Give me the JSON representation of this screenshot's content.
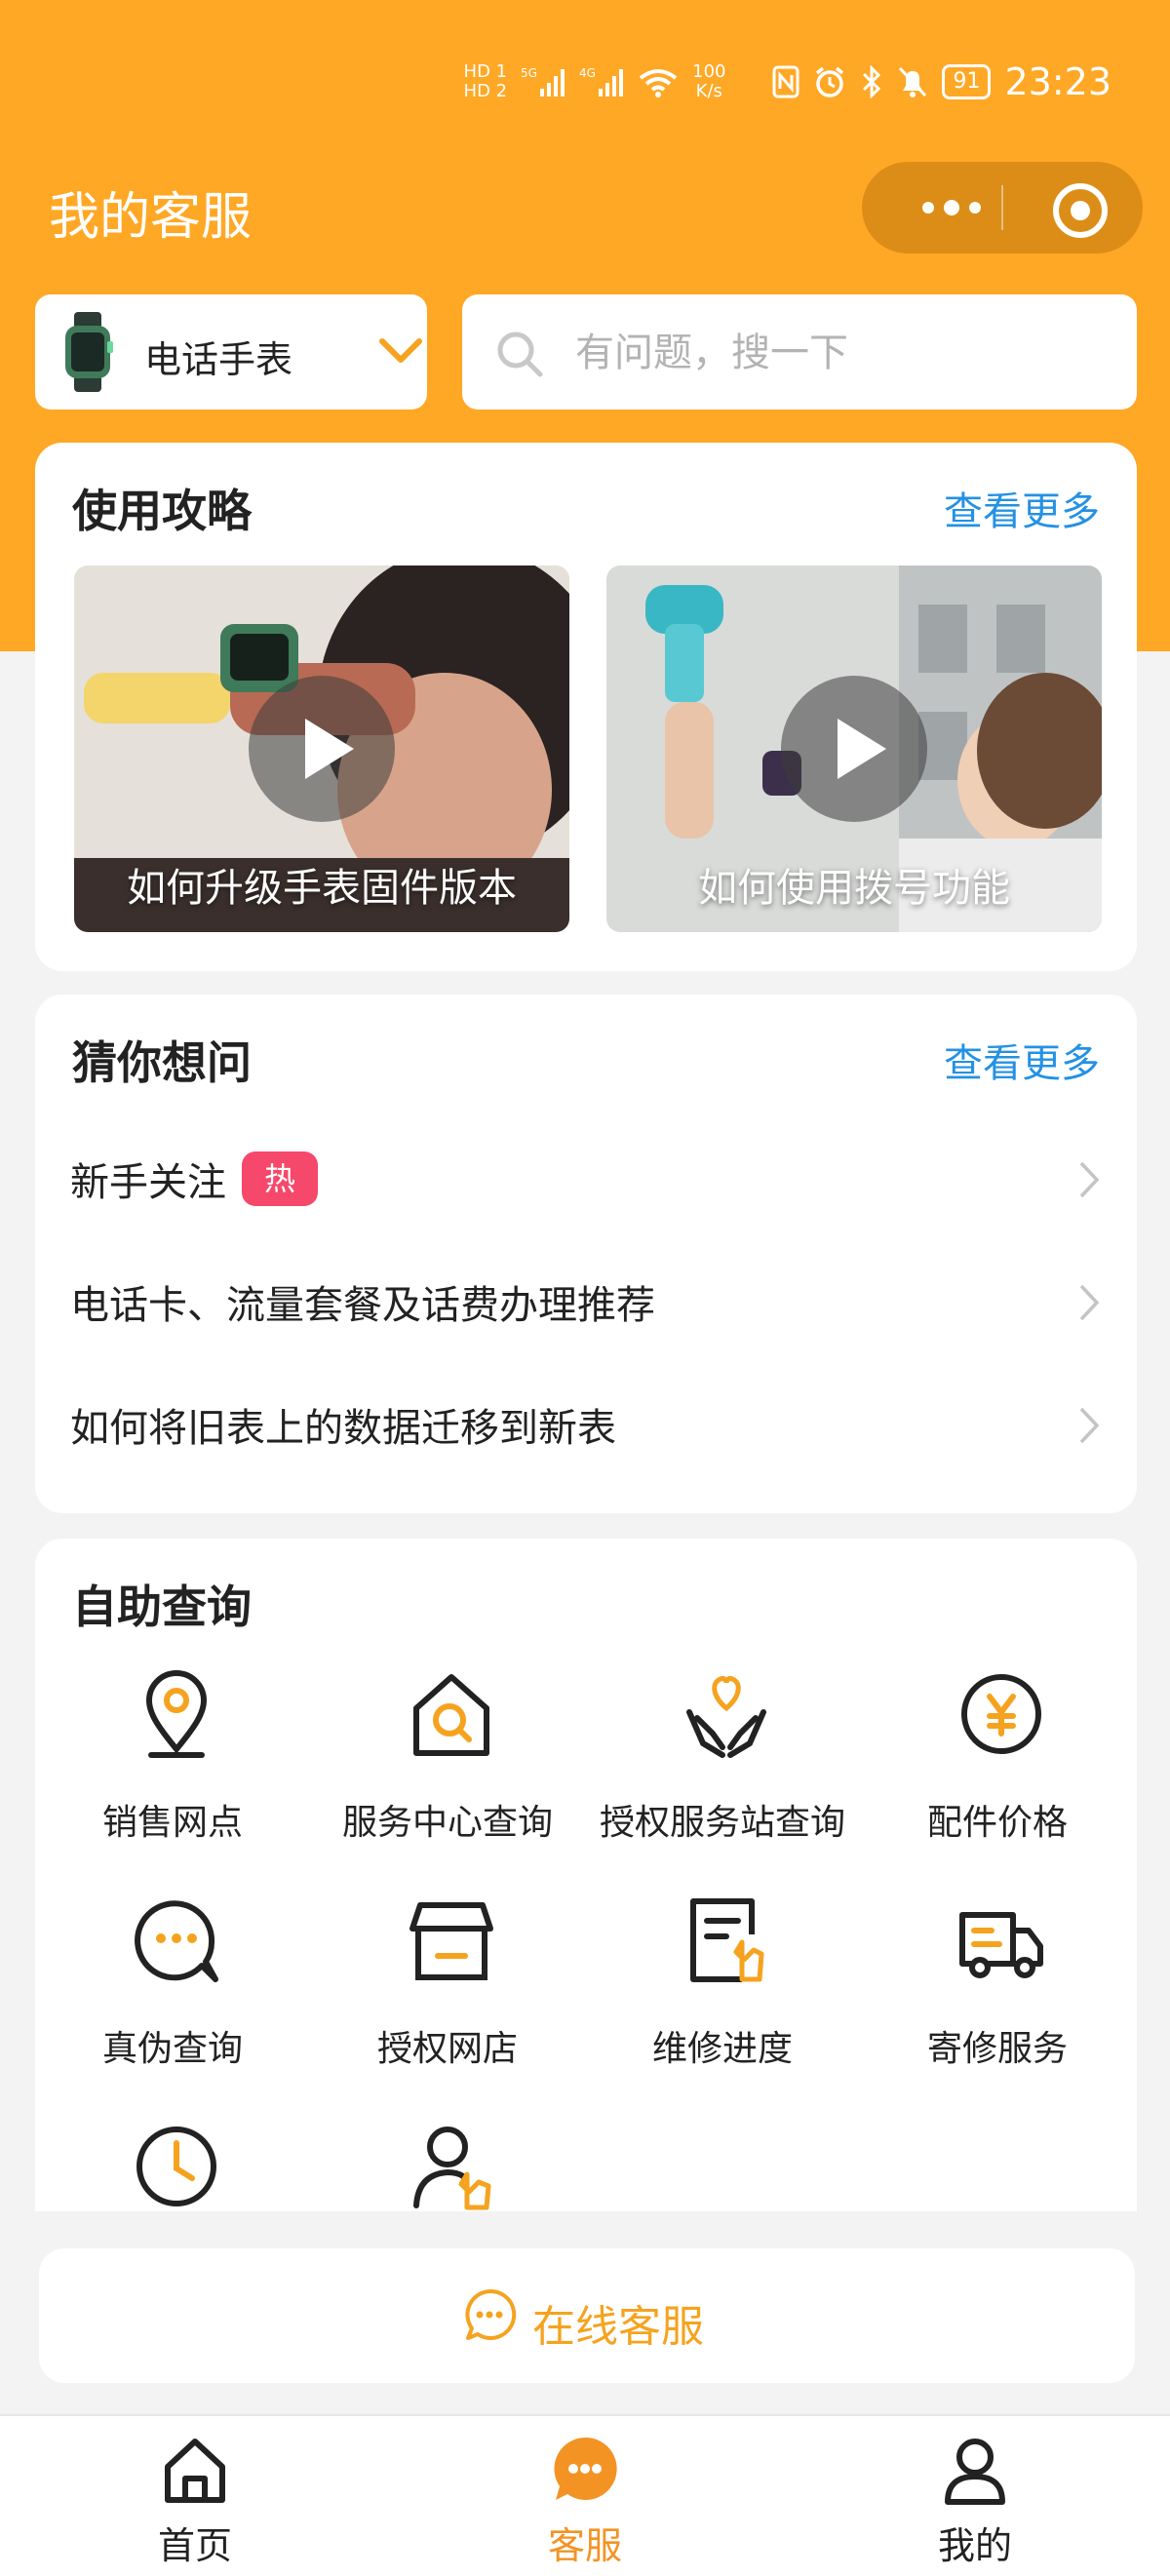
{
  "status_bar": {
    "net_top": "HD 1",
    "net_bottom": "HD 2",
    "signal1": "5G",
    "signal2": "4G",
    "speed_value": "100",
    "speed_unit": "K/s",
    "battery": "91",
    "time": "23:23"
  },
  "header": {
    "title": "我的客服"
  },
  "device_selector": {
    "label": "电话手表"
  },
  "search": {
    "placeholder": "有问题，搜一下"
  },
  "guides": {
    "title": "使用攻略",
    "more": "查看更多",
    "videos": [
      {
        "caption": "如何升级手表固件版本"
      },
      {
        "caption": "如何使用拨号功能"
      }
    ]
  },
  "faq": {
    "title": "猜你想问",
    "more": "查看更多",
    "items": [
      {
        "text": "新手关注",
        "badge": "热"
      },
      {
        "text": "电话卡、流量套餐及话费办理推荐"
      },
      {
        "text": "如何将旧表上的数据迁移到新表"
      }
    ]
  },
  "self_service": {
    "title": "自助查询",
    "items": [
      {
        "label": "销售网点",
        "icon": "location-pin-icon"
      },
      {
        "label": "服务中心查询",
        "icon": "house-search-icon"
      },
      {
        "label": "授权服务站查询",
        "icon": "heart-hands-icon"
      },
      {
        "label": "配件价格",
        "icon": "yen-coin-icon"
      },
      {
        "label": "真伪查询",
        "icon": "chat-search-icon"
      },
      {
        "label": "授权网店",
        "icon": "storefront-icon"
      },
      {
        "label": "维修进度",
        "icon": "repair-document-icon"
      },
      {
        "label": "寄修服务",
        "icon": "delivery-truck-icon"
      },
      {
        "label": "",
        "icon": "clock-icon"
      },
      {
        "label": "",
        "icon": "person-wrench-icon"
      }
    ]
  },
  "online_service": {
    "label": "在线客服"
  },
  "tabbar": [
    {
      "label": "首页"
    },
    {
      "label": "客服",
      "active": true
    },
    {
      "label": "我的"
    }
  ],
  "colors": {
    "brand": "#ffa826",
    "accent": "#f5a31f",
    "link": "#2491e3",
    "hot": "#f5486a"
  }
}
